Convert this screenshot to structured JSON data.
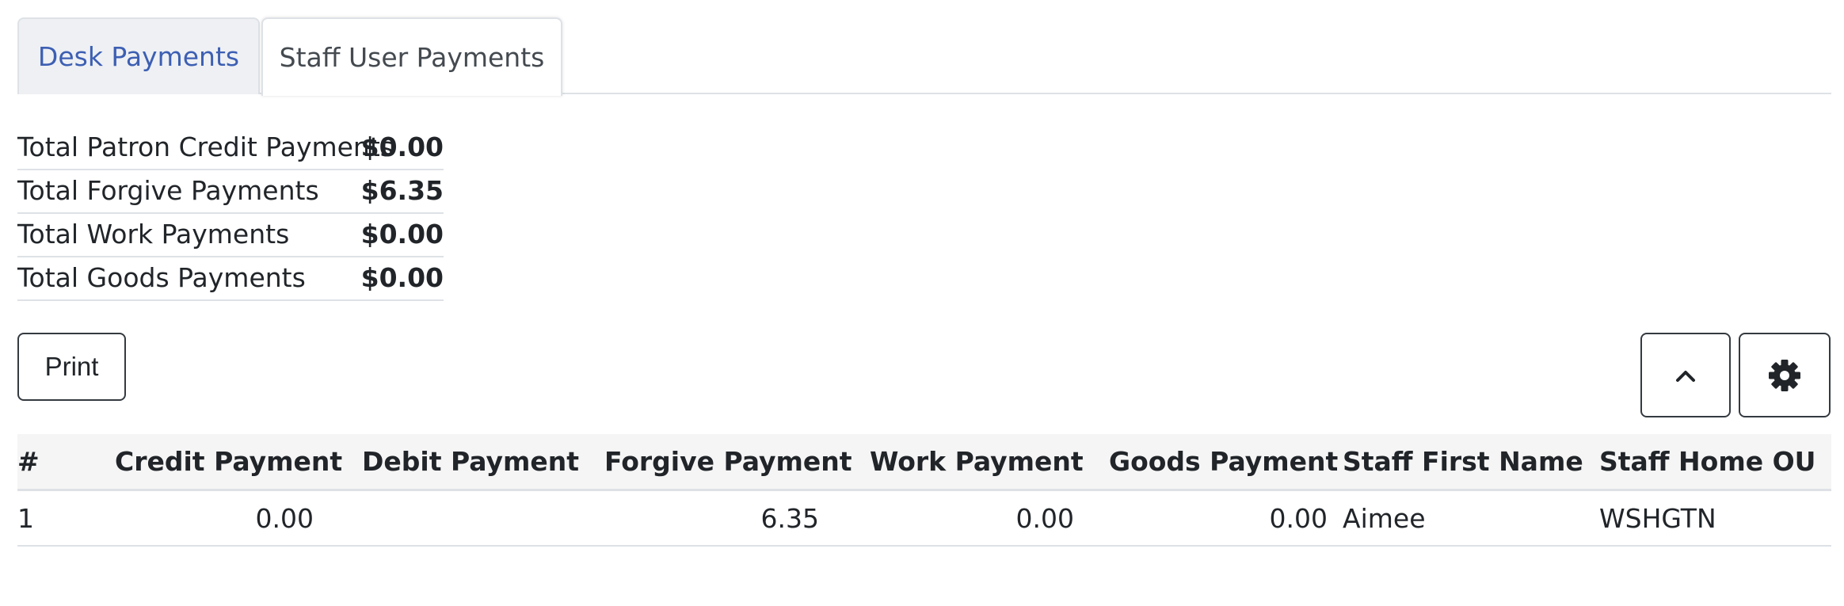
{
  "tabs": [
    {
      "label": "Desk Payments",
      "active": false
    },
    {
      "label": "Staff User Payments",
      "active": true
    }
  ],
  "totals": [
    {
      "label": "Total Patron Credit Payments",
      "value": "$0.00"
    },
    {
      "label": "Total Forgive Payments",
      "value": "$6.35"
    },
    {
      "label": "Total Work Payments",
      "value": "$0.00"
    },
    {
      "label": "Total Goods Payments",
      "value": "$0.00"
    }
  ],
  "toolbar": {
    "print_label": "Print",
    "collapse_icon": "chevron-up-icon",
    "settings_icon": "gear-icon"
  },
  "grid": {
    "columns": [
      "#",
      "Credit Payment",
      "Debit Payment",
      "Forgive Payment",
      "Work Payment",
      "Goods Payment",
      "Staff First Name",
      "Staff Home OU"
    ],
    "rows": [
      {
        "index": "1",
        "credit": "0.00",
        "debit": "",
        "forgive": "6.35",
        "work": "0.00",
        "goods": "0.00",
        "first_name": "Aimee",
        "home_ou": "WSHGTN"
      }
    ]
  },
  "colors": {
    "active_tab_text": "#444a50",
    "inactive_tab_text": "#3d5fb3",
    "border": "#dee2e6"
  }
}
